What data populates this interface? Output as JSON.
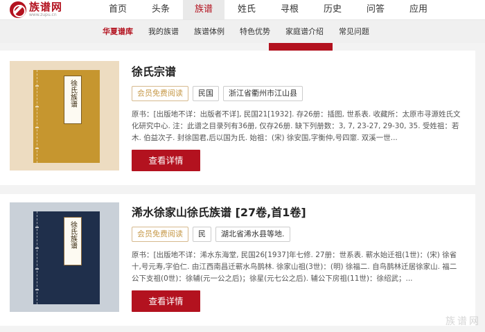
{
  "logo": {
    "name": "族谱网",
    "url": "www.zupu.cn"
  },
  "main_nav": [
    "首页",
    "头条",
    "族谱",
    "姓氏",
    "寻根",
    "历史",
    "问答",
    "应用"
  ],
  "main_nav_active": "族谱",
  "sub_nav": [
    "华夏谱库",
    "我的族谱",
    "族谱体例",
    "特色优势",
    "家庭谱介绍",
    "常见问题"
  ],
  "sub_nav_active": "华夏谱库",
  "cards": [
    {
      "cover_label": "徐氏族谱",
      "cover_color": "#c6962f",
      "title": "徐氏宗谱",
      "tags": [
        "会员免费阅读",
        "民国",
        "浙江省衢州市江山县"
      ],
      "desc": "原书：[出版地不详：出版者不详], 民国21[1932]. 存26册：插图, 世系表. 收藏所：太原市寻源姓氏文化研究中心. 注：此谱之目录列有36册, 仅存26册. 缺下列册数：3, 7, 23-27, 29-30, 35. 受姓祖：若木. 伯益次子. 封徐国君,后以国为氏. 始祖：(宋) 徐安国,字衡仲,号四窻. 双溪一世...",
      "button": "查看详情"
    },
    {
      "cover_label": "徐氏族谱",
      "cover_color": "#1f2f4b",
      "title": "浠水徐家山徐氏族谱 [27卷,首1卷]",
      "tags": [
        "会员免费阅读",
        "民",
        "湖北省浠水县等地."
      ],
      "desc": "原书：[出版地不详：浠水东海堂, 民国26[1937]年七修. 27册：世系表. 蕲水始迁祖(1世)：(宋) 徐省十,号元寿,字伯仁. 由江西南昌迁蕲水鸟鹊林. 徐家山祖(3世)：(明) 徐福二. 自鸟鹊林迁居徐家山. 福二公下支祖(0世)：徐辅(元一公之后)；徐星(元七公之后). 辅公下房祖(11世)：徐绍武；...",
      "button": "查看详情"
    }
  ],
  "watermark": "族谱网"
}
